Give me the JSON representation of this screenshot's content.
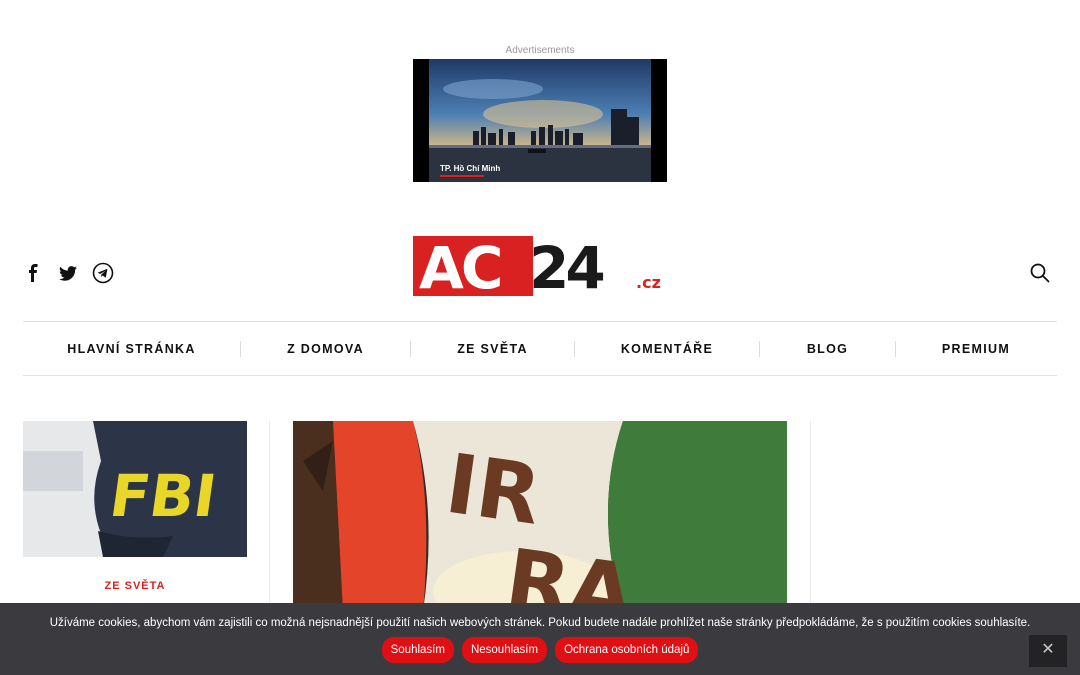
{
  "ad": {
    "label": "Advertisements",
    "caption": "TP. Hồ Chí Minh"
  },
  "header": {
    "logo_main": "AC24",
    "logo_suffix": ".cz",
    "social_icons": [
      "facebook-icon",
      "twitter-icon",
      "telegram-icon"
    ],
    "search_icon": "search-icon"
  },
  "nav": {
    "items": [
      {
        "label": "HLAVNÍ STRÁNKA"
      },
      {
        "label": "Z DOMOVA"
      },
      {
        "label": "ZE SVĚTA"
      },
      {
        "label": "KOMENTÁŘE"
      },
      {
        "label": "BLOG"
      },
      {
        "label": "PREMIUM"
      }
    ]
  },
  "content": {
    "left_card": {
      "category": "ZE SVĚTA"
    }
  },
  "cookie": {
    "text": "Užíváme cookies, abychom vám zajistili co možná nejsnadnější použití našich webových stránek. Pokud budete nadále prohlížet naše stránky předpokládáme, že s použitím cookies souhlasíte.",
    "accept": "Souhlasím",
    "decline": "Nesouhlasím",
    "privacy": "Ochrana osobních údajů",
    "close": "✕"
  },
  "colors": {
    "brand_red": "#d92121",
    "cookie_bg": "#3b3b3f",
    "button_red": "#e00f14"
  }
}
